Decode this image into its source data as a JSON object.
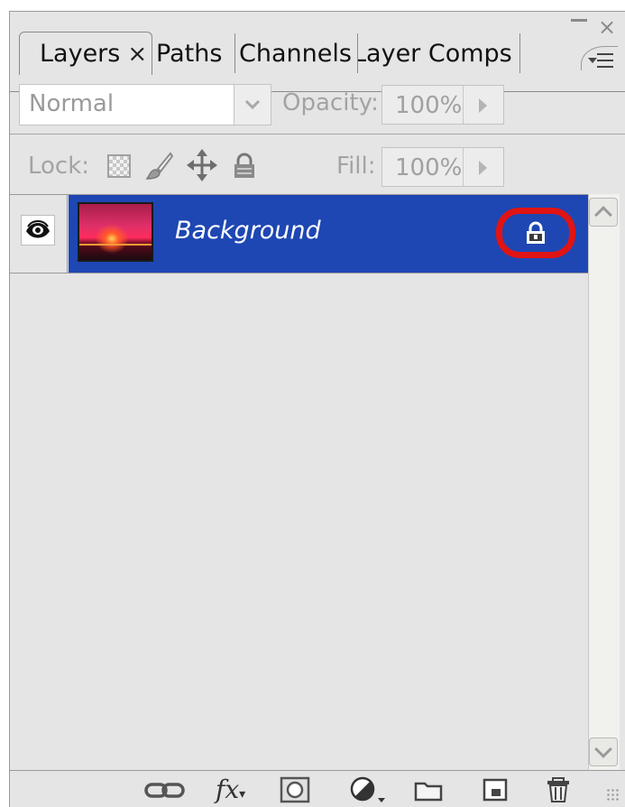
{
  "window": {
    "minimize_icon": "minimize-icon",
    "close_glyph": "×",
    "menu_icon": "panel-menu-icon"
  },
  "tabs": [
    {
      "label": "Layers",
      "active": true,
      "close_glyph": "×"
    },
    {
      "label": "Paths",
      "active": false
    },
    {
      "label": "Channels",
      "active": false
    },
    {
      "label": "Layer Comps",
      "active": false
    }
  ],
  "blend": {
    "mode": "Normal",
    "opacity_label": "Opacity:",
    "opacity_value": "100%"
  },
  "lock": {
    "label": "Lock:",
    "icons": [
      "lock-transparent-icon",
      "lock-image-icon",
      "lock-position-icon",
      "lock-all-icon"
    ],
    "fill_label": "Fill:",
    "fill_value": "100%"
  },
  "layers": [
    {
      "name": "Background",
      "visible": true,
      "locked": true,
      "selected": true
    }
  ],
  "toolbar": {
    "icons": [
      "link-layers-icon",
      "fx-icon",
      "layer-mask-icon",
      "adjustment-layer-icon",
      "new-group-icon",
      "new-layer-icon",
      "trash-icon"
    ],
    "fx_label": "fx"
  },
  "colors": {
    "selection": "#1e47b3",
    "highlight": "#e01414",
    "panel": "#e5e5e5"
  }
}
